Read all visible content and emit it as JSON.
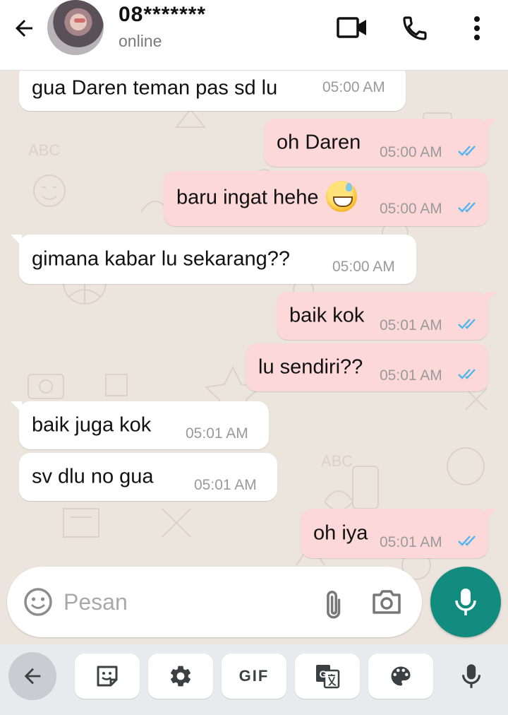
{
  "header": {
    "contact_name": "08*******",
    "status": "online",
    "icons": [
      "arrow-left-icon",
      "avatar",
      "video-camera-icon",
      "phone-icon",
      "more-vert-icon"
    ]
  },
  "messages": [
    {
      "direction": "in",
      "text": "gua Daren teman pas sd lu",
      "time": "05:00 AM"
    },
    {
      "direction": "out",
      "text": "oh Daren",
      "time": "05:00 AM",
      "read": true
    },
    {
      "direction": "out",
      "text": "baru ingat hehe",
      "emoji": "sweat-smile",
      "time": "05:00 AM",
      "read": true
    },
    {
      "direction": "in",
      "text": "gimana kabar lu sekarang??",
      "time": "05:00 AM"
    },
    {
      "direction": "out",
      "text": "baik kok",
      "time": "05:01 AM",
      "read": true
    },
    {
      "direction": "out",
      "text": "lu sendiri??",
      "time": "05:01 AM",
      "read": true
    },
    {
      "direction": "in",
      "text": "baik juga kok",
      "time": "05:01 AM"
    },
    {
      "direction": "in",
      "text": "sv dlu no gua",
      "time": "05:01 AM"
    },
    {
      "direction": "out",
      "text": "oh iya",
      "time": "05:01 AM",
      "read": true
    }
  ],
  "composer": {
    "placeholder": "Pesan",
    "value": ""
  },
  "keyboard_toolbar": {
    "gif_label": "GIF",
    "icons": [
      "back-arrow-icon",
      "sticker-icon",
      "settings-gear-icon",
      "gif-icon",
      "translate-icon",
      "palette-icon",
      "mic-icon"
    ]
  },
  "colors": {
    "header_bg": "#ffffff",
    "chat_bg": "#ece5dd",
    "incoming_bubble": "#ffffff",
    "outgoing_bubble": "#fcd8d8",
    "read_ticks": "#4fb6ec",
    "mic_fab": "#128c7e",
    "keyboard_bar": "#e8eaed"
  }
}
